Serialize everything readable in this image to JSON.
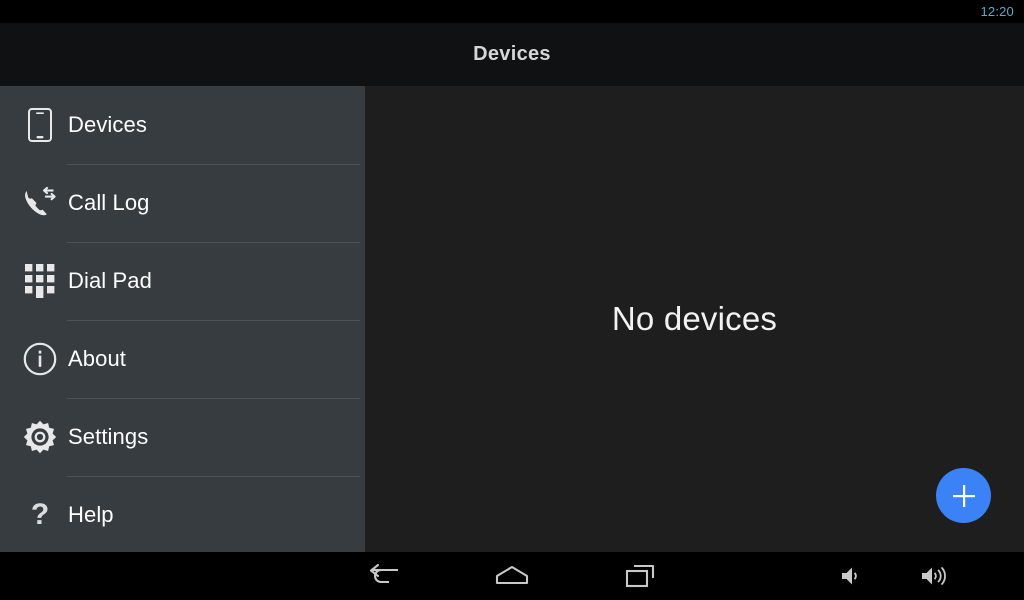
{
  "status_bar": {
    "clock": "12:20",
    "clock_color": "#5ea8c9",
    "background": "#000000"
  },
  "action_bar": {
    "title": "Devices",
    "background": "#0f1113",
    "title_color": "#d6d6d6"
  },
  "nav_drawer": {
    "background": "#363c40",
    "divider_color": "#4c5357",
    "label_color": "#ffffff",
    "items": [
      {
        "label": "Devices",
        "icon": "smartphone-icon",
        "selected": true
      },
      {
        "label": "Call Log",
        "icon": "call-swap-icon",
        "selected": false
      },
      {
        "label": "Dial Pad",
        "icon": "dialpad-icon",
        "selected": false
      },
      {
        "label": "About",
        "icon": "info-circle-icon",
        "selected": false
      },
      {
        "label": "Settings",
        "icon": "gear-icon",
        "selected": false
      },
      {
        "label": "Help",
        "icon": "question-mark-icon",
        "selected": false
      }
    ]
  },
  "main": {
    "background": "#1e1e1e",
    "empty_state_text": "No devices",
    "empty_state_color": "#f2f2f2",
    "fab": {
      "icon": "plus-icon",
      "color": "#3b82f6",
      "glyph_color": "#ffffff"
    }
  },
  "system_nav_bar": {
    "background": "#000000",
    "icon_color": "#c8c8c8",
    "buttons": [
      {
        "name": "back-icon",
        "label": "Back"
      },
      {
        "name": "home-icon",
        "label": "Home"
      },
      {
        "name": "recents-icon",
        "label": "Recent apps"
      },
      {
        "name": "volume-down-icon",
        "label": "Volume down"
      },
      {
        "name": "volume-up-icon",
        "label": "Volume up"
      }
    ]
  }
}
